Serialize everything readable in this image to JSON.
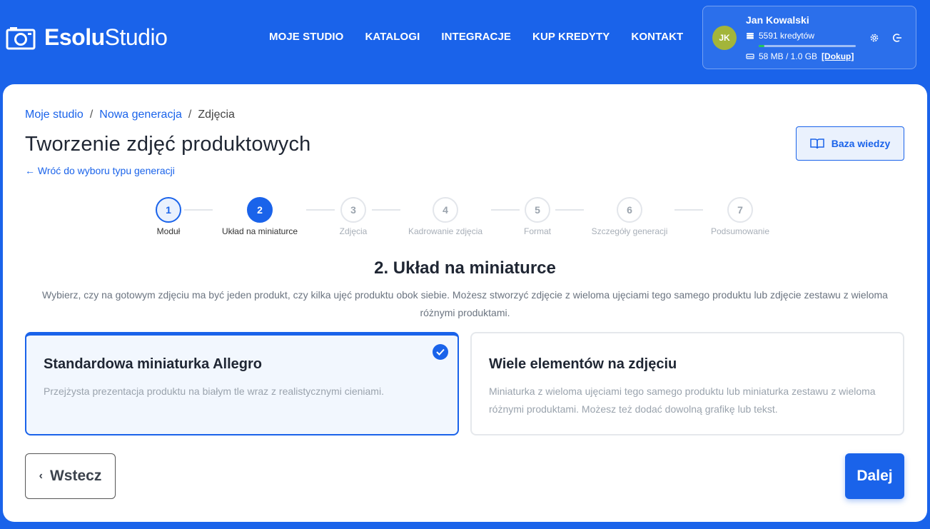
{
  "colors": {
    "brand": "#1a63ea",
    "avatar": "#a3b53a",
    "credit_fill": "#22c55e"
  },
  "logo": {
    "bold": "Esolu",
    "light": "Studio"
  },
  "nav": [
    {
      "label": "MOJE STUDIO"
    },
    {
      "label": "KATALOGI"
    },
    {
      "label": "INTEGRACJE"
    },
    {
      "label": "KUP KREDYTY"
    },
    {
      "label": "KONTAKT"
    }
  ],
  "user": {
    "initials": "JK",
    "name": "Jan Kowalski",
    "credits": "5591 kredytów",
    "credit_fill_fraction": 0.06,
    "storage": "58 MB / 1.0 GB",
    "dokup": "[Dokup]"
  },
  "breadcrumb": {
    "items": [
      "Moje studio",
      "Nowa generacja"
    ],
    "current": "Zdjęcia",
    "sep": "/"
  },
  "page": {
    "title": "Tworzenie zdjęć produktowych",
    "back_link": "← Wróć do wyboru typu generacji",
    "kb_button": "Baza wiedzy"
  },
  "stepper": [
    {
      "num": "1",
      "label": "Moduł",
      "state": "done"
    },
    {
      "num": "2",
      "label": "Układ na miniaturce",
      "state": "active"
    },
    {
      "num": "3",
      "label": "Zdjęcia",
      "state": "todo"
    },
    {
      "num": "4",
      "label": "Kadrowanie zdjęcia",
      "state": "todo"
    },
    {
      "num": "5",
      "label": "Format",
      "state": "todo"
    },
    {
      "num": "6",
      "label": "Szczegóły generacji",
      "state": "todo"
    },
    {
      "num": "7",
      "label": "Podsumowanie",
      "state": "todo"
    }
  ],
  "section": {
    "title": "2. Układ na miniaturce",
    "description": "Wybierz, czy na gotowym zdjęciu ma być jeden produkt, czy kilka ujęć produktu obok siebie. Możesz stworzyć zdjęcie z wieloma ujęciami tego samego produktu lub zdjęcie zestawu z wieloma różnymi produktami."
  },
  "options": [
    {
      "title": "Standardowa miniaturka Allegro",
      "desc": "Przejżysta prezentacja produktu na białym tle wraz z realistycznymi cieniami.",
      "selected": true
    },
    {
      "title": "Wiele elementów na zdjęciu",
      "desc": "Miniaturka z wieloma ujęciami tego samego produktu lub miniaturka zestawu z wieloma różnymi produktami. Możesz też dodać dowolną grafikę lub tekst.",
      "selected": false
    }
  ],
  "buttons": {
    "back": "Wstecz",
    "back_icon": "‹",
    "next": "Dalej"
  }
}
